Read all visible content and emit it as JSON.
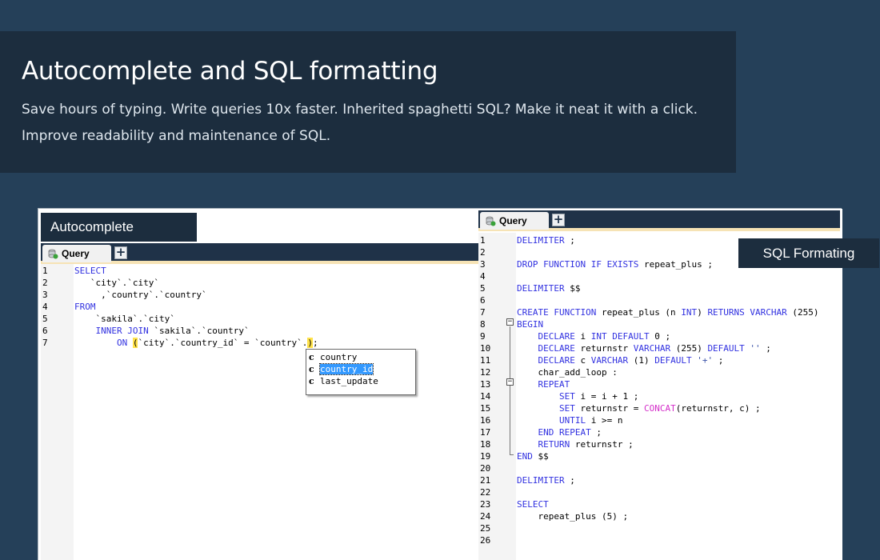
{
  "hero": {
    "title": "Autocomplete and SQL formatting",
    "description": "Save hours of typing. Write queries 10x faster. Inherited spaghetti SQL? Make it neat it with a click.  Improve readability and maintenance of SQL."
  },
  "left_editor": {
    "label": "Autocomplete",
    "tab_label": "Query",
    "line_numbers": [
      "1",
      "2",
      "3",
      "4",
      "5",
      "6",
      "7"
    ],
    "autocomplete_items": [
      "country",
      "country_id",
      "last_update"
    ],
    "autocomplete_selected": "country_id"
  },
  "right_editor": {
    "label": "SQL Formating",
    "tab_label": "Query",
    "line_numbers": [
      "1",
      "2",
      "3",
      "4",
      "5",
      "6",
      "7",
      "8",
      "9",
      "10",
      "11",
      "12",
      "13",
      "14",
      "15",
      "16",
      "17",
      "18",
      "19",
      "20",
      "21",
      "22",
      "23",
      "24",
      "25",
      "26"
    ]
  },
  "colors": {
    "page_bg": "#254059",
    "hero_bg": "#1c2d3e",
    "keyword": "#3131e0",
    "function": "#d42fc9",
    "highlight": "#ffe24a",
    "selection": "#3399ff"
  }
}
